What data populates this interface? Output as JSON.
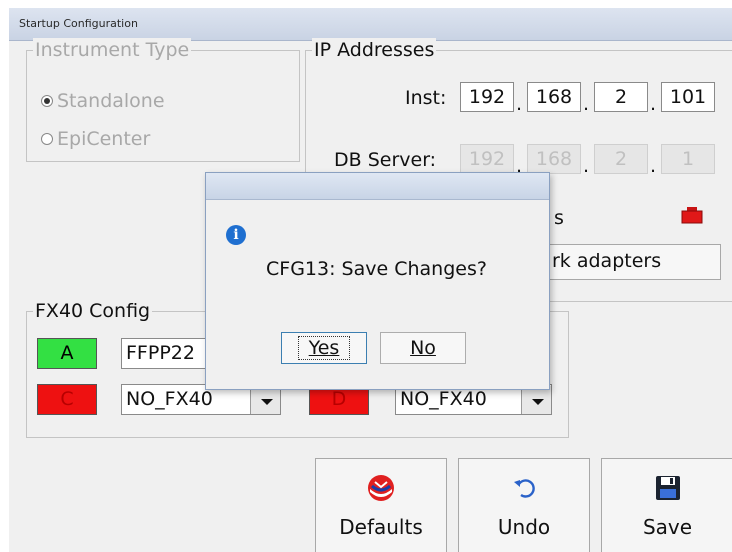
{
  "window": {
    "title": "Startup Configuration"
  },
  "instrument_type": {
    "title": "Instrument Type",
    "options": [
      {
        "label": "Standalone",
        "selected": true
      },
      {
        "label": "EpiCenter",
        "selected": false
      }
    ]
  },
  "ip": {
    "title": "IP Addresses",
    "inst_label": "Inst:",
    "inst": [
      "192",
      "168",
      "2",
      "101"
    ],
    "db_label": "DB Server:",
    "db": [
      "192",
      "168",
      "2",
      "1"
    ],
    "status_text": "s",
    "adapters_label": "rk adapters"
  },
  "fx40": {
    "title": "FX40 Config",
    "a_label": "A",
    "a_value": "FFPP22",
    "c_label": "C",
    "c_value": "NO_FX40",
    "d_label": "D",
    "d_value": "NO_FX40",
    "green": "#33e043",
    "red": "#ee1111"
  },
  "buttons": {
    "defaults": "Defaults",
    "undo": "Undo",
    "save": "Save"
  },
  "dialog": {
    "message": "CFG13: Save Changes?",
    "yes": "Yes",
    "no": "No",
    "icon": "info-icon"
  }
}
